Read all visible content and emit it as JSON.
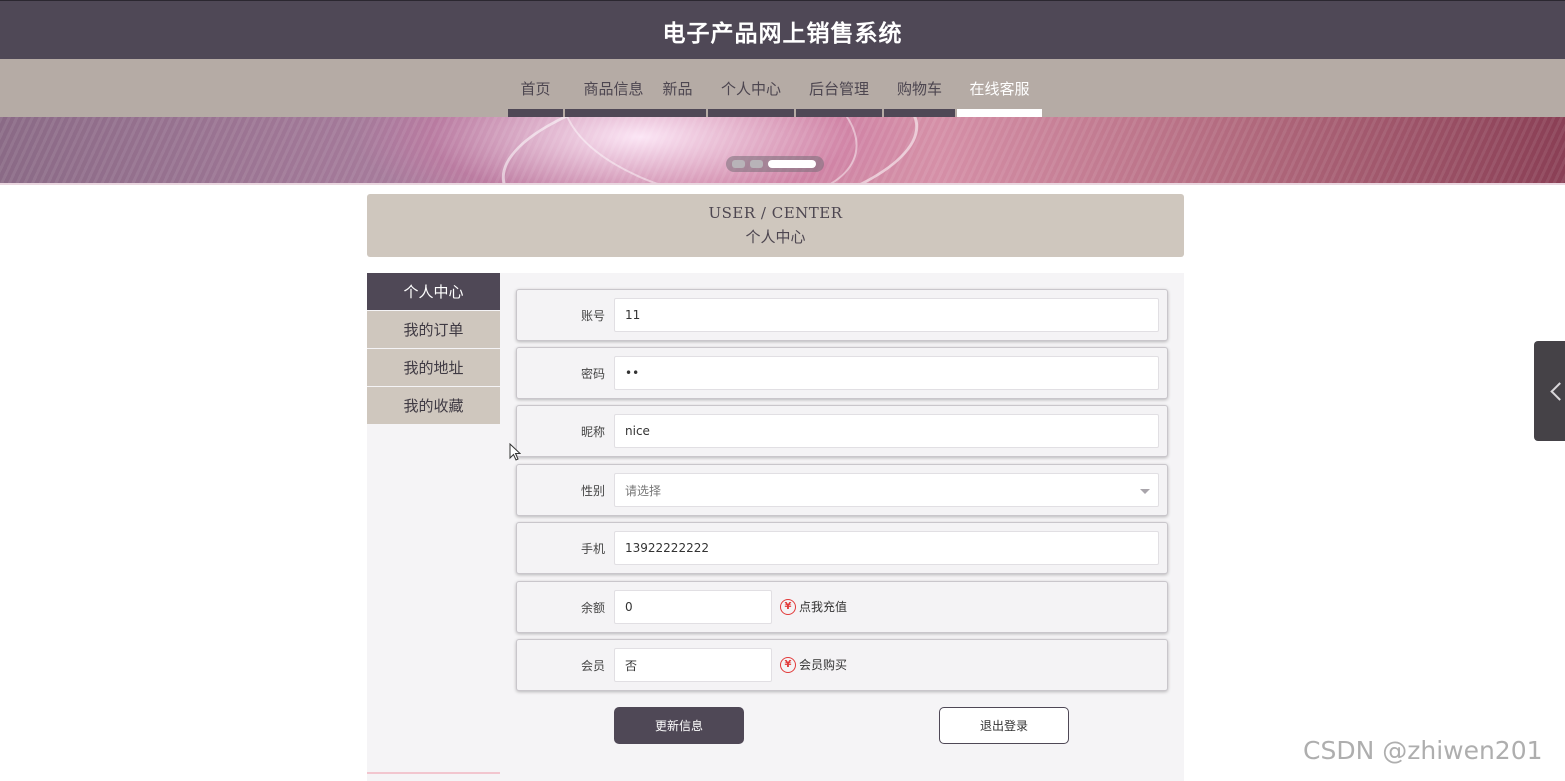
{
  "header": {
    "title": "电子产品网上销售系统"
  },
  "nav": {
    "items": [
      {
        "label": "首页"
      },
      {
        "label": "商品信息"
      },
      {
        "label": "新品"
      },
      {
        "label": "个人中心"
      },
      {
        "label": "后台管理"
      },
      {
        "label": "购物车"
      },
      {
        "label": "在线客服",
        "active": true
      }
    ]
  },
  "banner": {
    "slide_count": 3,
    "active_slide": 3
  },
  "section": {
    "title_en": "USER / CENTER",
    "title_cn": "个人中心"
  },
  "sidebar": {
    "items": [
      {
        "label": "个人中心",
        "active": true
      },
      {
        "label": "我的订单"
      },
      {
        "label": "我的地址"
      },
      {
        "label": "我的收藏"
      }
    ]
  },
  "form": {
    "account": {
      "label": "账号",
      "value": "11"
    },
    "password": {
      "label": "密码",
      "value": "••"
    },
    "nickname": {
      "label": "昵称",
      "value": "nice"
    },
    "gender": {
      "label": "性别",
      "value": "请选择"
    },
    "phone": {
      "label": "手机",
      "value": "13922222222"
    },
    "balance": {
      "label": "余额",
      "value": "0",
      "action": "点我充值",
      "icon": "yen-icon"
    },
    "member": {
      "label": "会员",
      "value": "否",
      "action": "会员购买",
      "icon": "yen-icon"
    }
  },
  "buttons": {
    "update": "更新信息",
    "logout": "退出登录"
  },
  "watermark": "CSDN @zhiwen201",
  "colors": {
    "primary": "#4f4856",
    "nav_bg": "#b5aba5",
    "accent_beige": "#cfc7be",
    "yen_red": "#e23b3b"
  }
}
